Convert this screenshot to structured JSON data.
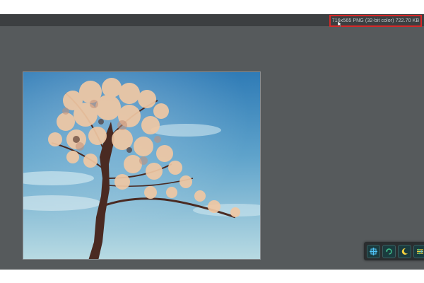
{
  "viewer": {
    "image_info": "716x565 PNG (32-bit color) 722.70 KB"
  },
  "toolbar": {
    "buttons": [
      {
        "icon": "fit-to-window-icon"
      },
      {
        "icon": "rotate-icon"
      },
      {
        "icon": "night-mode-icon"
      },
      {
        "icon": "settings-icon"
      }
    ]
  },
  "colors": {
    "viewer_bg": "#565a5c",
    "topbar_bg": "#3c3f41",
    "highlight_border": "#d62828",
    "sky_top": "#3f87bf",
    "blossom": "#f2c9a6"
  }
}
